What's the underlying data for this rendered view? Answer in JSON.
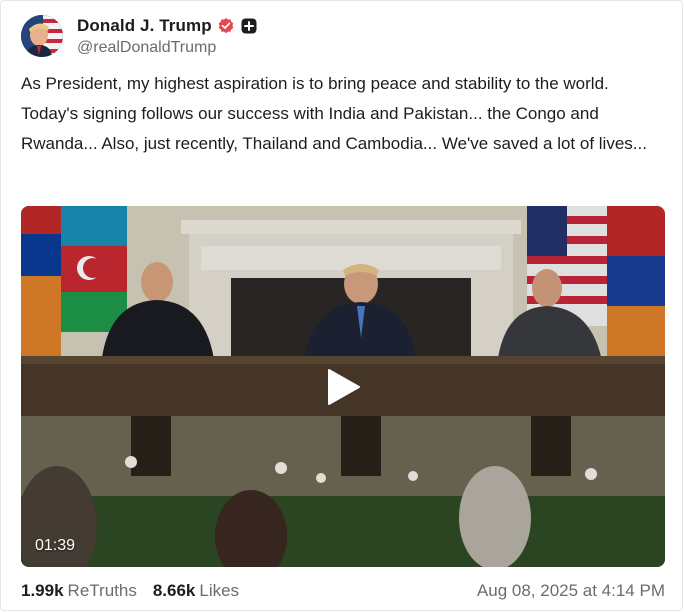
{
  "post": {
    "author": {
      "display_name": "Donald J. Trump",
      "handle": "@realDonaldTrump",
      "verified_icon": "verified-badge-icon",
      "plus_icon": "plus-badge-icon"
    },
    "text": "As President, my highest aspiration is to bring peace and stability to the world. Today's signing follows our success with India and Pakistan... the Congo and Rwanda... Also, just recently, Thailand and Cambodia... We've saved a lot of lives...",
    "media": {
      "type": "video",
      "duration": "01:39",
      "play_icon": "play-icon"
    },
    "stats": {
      "retruths_count": "1.99k",
      "retruths_label": "ReTruths",
      "likes_count": "8.66k",
      "likes_label": "Likes"
    },
    "timestamp": "Aug 08, 2025 at 4:14 PM"
  },
  "colors": {
    "text_primary": "#1d1d1f",
    "text_secondary": "#6b6b76",
    "verified": "#e5484d",
    "border": "#e6e6e9"
  }
}
